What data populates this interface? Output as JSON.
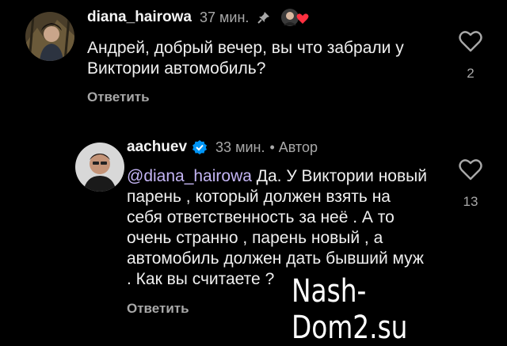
{
  "comments": [
    {
      "username": "diana_hairowa",
      "time": "37 мин.",
      "author_tag": "",
      "text": "Андрей, добрый вечер, вы что забрали у Виктории автомобиль?",
      "mention": "",
      "likes": "2",
      "reply_label": "Ответить",
      "icons": [
        "pin-icon",
        "creator-liked-icon",
        "heart-outline-icon"
      ]
    },
    {
      "username": "aachuev",
      "time": "33 мин.",
      "author_tag": "• Автор",
      "mention": "@diana_hairowa",
      "text": "Да. У Виктории новый парень , который должен взять на себя ответственность за неё . А то очень странно , парень новый , а автомобиль должен дать бывший муж . Как вы считаете ?",
      "likes": "13",
      "reply_label": "Ответить",
      "icons": [
        "verified-badge-icon",
        "heart-outline-icon"
      ]
    }
  ],
  "watermark": "Nash-Dom2.su",
  "colors": {
    "background": "#000000",
    "secondary_text": "#a8a8a8",
    "mention": "#c4b5f4",
    "verified": "#0095f6",
    "heart_red": "#ff3040"
  }
}
